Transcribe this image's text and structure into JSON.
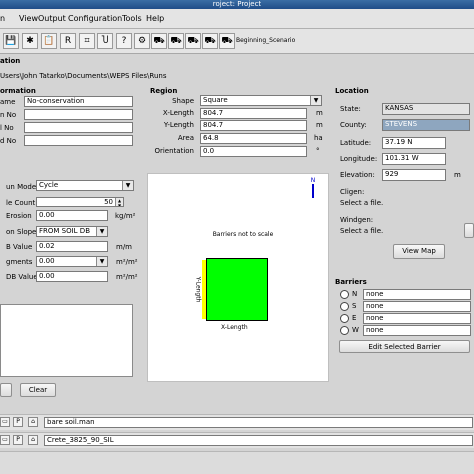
{
  "window": {
    "title": "roject: Project"
  },
  "menu": [
    "n",
    "ViewOutput",
    "Configuration",
    "Tools",
    "Help"
  ],
  "toolbar": {
    "scenario_label": "Beginning_Scenario"
  },
  "path_section": {
    "title": "ation",
    "path": "Users\\John Tatarko\\Documents\\WEPS Files\\Runs"
  },
  "information": {
    "title": "ormation",
    "labels": [
      "ame",
      "n No",
      "l No",
      "d No"
    ],
    "values": [
      "No-conservation",
      "",
      "",
      ""
    ]
  },
  "region": {
    "title": "Region",
    "shape_label": "Shape",
    "shape_value": "Square",
    "x_label": "X-Length",
    "x_value": "804.7",
    "x_unit": "m",
    "y_label": "Y-Length",
    "y_value": "804.7",
    "y_unit": "m",
    "area_label": "Area",
    "area_value": "64.8",
    "area_unit": "ha",
    "orientation_label": "Orientation",
    "orientation_value": "0.0",
    "orientation_unit": "°"
  },
  "location": {
    "title": "Location",
    "state_label": "State:",
    "state_value": "KANSAS",
    "county_label": "County:",
    "county_value": "STEVENS",
    "latitude_label": "Latitude:",
    "latitude_value": "37.19 N",
    "longitude_label": "Longitude:",
    "longitude_value": "101.31 W",
    "elevation_label": "Elevation:",
    "elevation_value": "929",
    "elevation_unit": "m",
    "cligen_label": "Cligen:",
    "cligen_value": "Select a file.",
    "windgen_label": "Windgen:",
    "windgen_value": "Select a file.",
    "view_map_label": "View Map"
  },
  "run_settings": {
    "mode_label": "un Mode",
    "mode_value": "Cycle",
    "cycle_label": "le Count",
    "cycle_value": "50",
    "erosion_label": "Erosion",
    "erosion_value": "0.00",
    "erosion_unit": "kg/m²",
    "slope_label": "on Slope",
    "slope_value": "FROM SOIL DB",
    "value_label": "B Value",
    "value_value": "0.02",
    "value_unit": "m/m",
    "fragments_label": "gments",
    "fragments_value": "0.00",
    "fragments_unit": "m²/m²",
    "db_label": "DB Value",
    "db_value": "0.00",
    "db_unit": "m²/m²"
  },
  "notes": {
    "clear_label": "Clear"
  },
  "diagram": {
    "banner": "Barriers not to scale",
    "y_label": "Y-Length",
    "x_label": "X-Length",
    "north_arrow": "N",
    "field_color": "#00ff00",
    "barrier_color": "#ffff00"
  },
  "barriers": {
    "title": "Barriers",
    "rows": [
      {
        "dir": "N",
        "value": "none"
      },
      {
        "dir": "S",
        "value": "none"
      },
      {
        "dir": "E",
        "value": "none"
      },
      {
        "dir": "W",
        "value": "none"
      }
    ],
    "edit_label": "Edit Selected Barrier"
  },
  "bottom": {
    "row1_file": "bare soil.man",
    "row2_file": "Crete_3825_90_SIL"
  }
}
